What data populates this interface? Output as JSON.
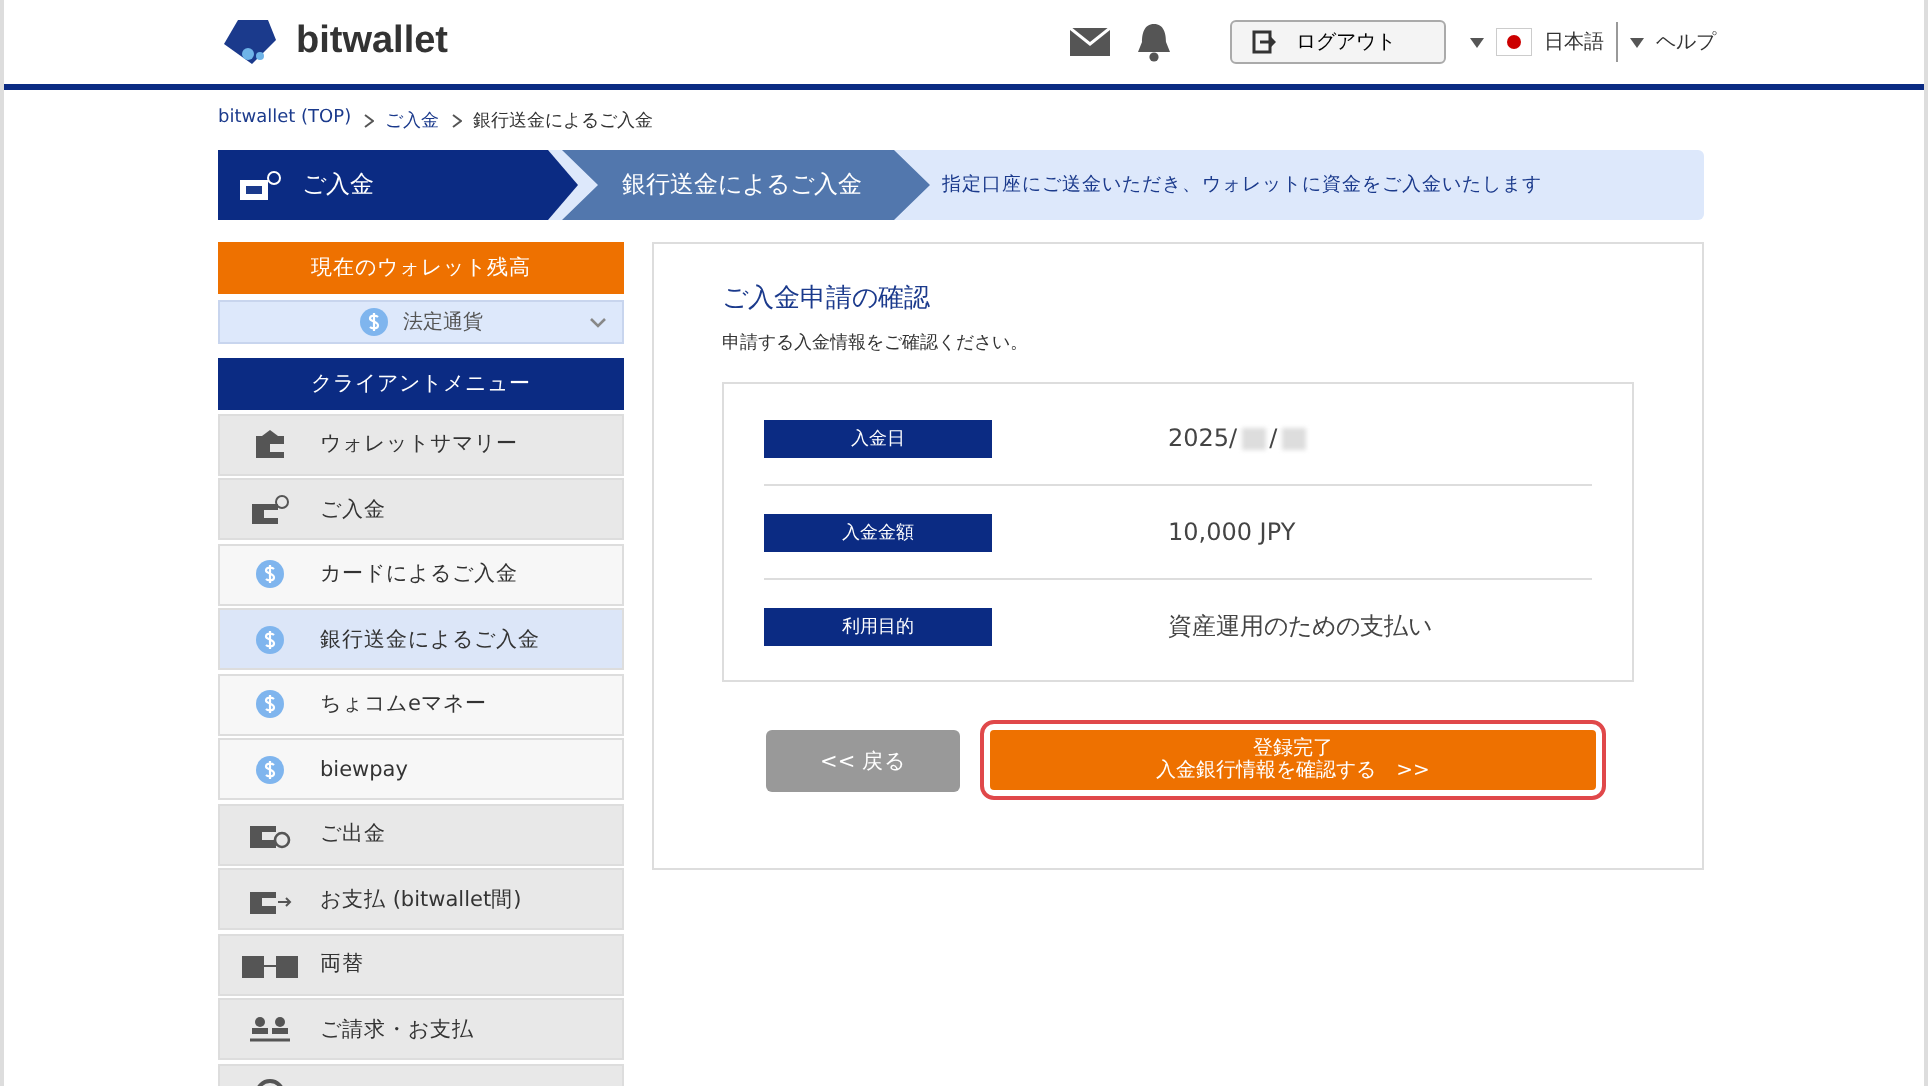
{
  "header": {
    "logo": "bitwallet",
    "logout": "ログアウト",
    "language": "日本語",
    "help": "ヘルプ"
  },
  "breadcrumb": [
    {
      "label": "bitwallet (TOP)",
      "link": true
    },
    {
      "label": "ご入金",
      "link": true
    },
    {
      "label": "銀行送金によるご入金",
      "link": false
    }
  ],
  "steps": [
    {
      "label": "ご入金",
      "selected": true
    },
    {
      "label": "銀行送金によるご入金",
      "selected": false
    }
  ],
  "step_note": "指定口座にご送金いただき、ウォレットに資金をご入金いたします",
  "sidebar": {
    "balance_title": "現在のウォレット残高",
    "currency": "法定通貨",
    "menu_title": "クライアントメニュー",
    "items": [
      {
        "label": "ウォレットサマリー",
        "kind": "main",
        "selected": false
      },
      {
        "label": "ご入金",
        "kind": "main",
        "selected": false
      },
      {
        "label": "カードによるご入金",
        "kind": "sub",
        "selected": false
      },
      {
        "label": "銀行送金によるご入金",
        "kind": "sub",
        "selected": true
      },
      {
        "label": "ちょコムeマネー",
        "kind": "sub",
        "selected": false
      },
      {
        "label": "biewpay",
        "kind": "sub",
        "selected": false
      },
      {
        "label": "ご出金",
        "kind": "main",
        "selected": false
      },
      {
        "label": "お支払 (bitwallet間)",
        "kind": "main",
        "selected": false
      },
      {
        "label": "両替",
        "kind": "main",
        "selected": false
      },
      {
        "label": "ご請求・お支払",
        "kind": "main",
        "selected": false
      },
      {
        "kind": "main",
        "selected": false
      }
    ]
  },
  "panel": {
    "title": "ご入金申請の確認",
    "subtitle": "申請する入金情報をご確認ください。",
    "rows": [
      {
        "label": "入金日",
        "value_segments": [
          "2025/",
          "/"
        ],
        "redacted": true
      },
      {
        "label": "入金金額",
        "value_segments": [
          "10,000 JPY"
        ],
        "redacted": false
      },
      {
        "label": "利用目的",
        "value_segments": [
          "資産運用のための支払い"
        ],
        "redacted": false
      }
    ],
    "back_button": "<< 戻る",
    "confirm_button": [
      "登録完了",
      "入金銀行情報を確認する　>>"
    ]
  }
}
